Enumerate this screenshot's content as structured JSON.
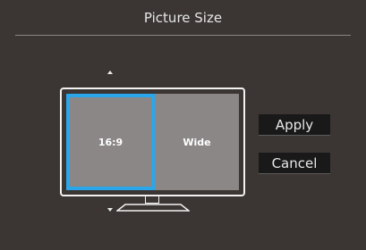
{
  "header": {
    "title": "Picture Size"
  },
  "options": [
    {
      "label": "16:9",
      "selected": true
    },
    {
      "label": "Wide",
      "selected": false
    }
  ],
  "buttons": {
    "apply": "Apply",
    "cancel": "Cancel"
  },
  "colors": {
    "selection": "#2aa6ea",
    "background": "#3b3634",
    "screen": "#8a8786",
    "button": "#191919"
  },
  "icons": {
    "up": "arrow-up-icon",
    "down": "arrow-down-icon",
    "monitor": "monitor-icon"
  }
}
